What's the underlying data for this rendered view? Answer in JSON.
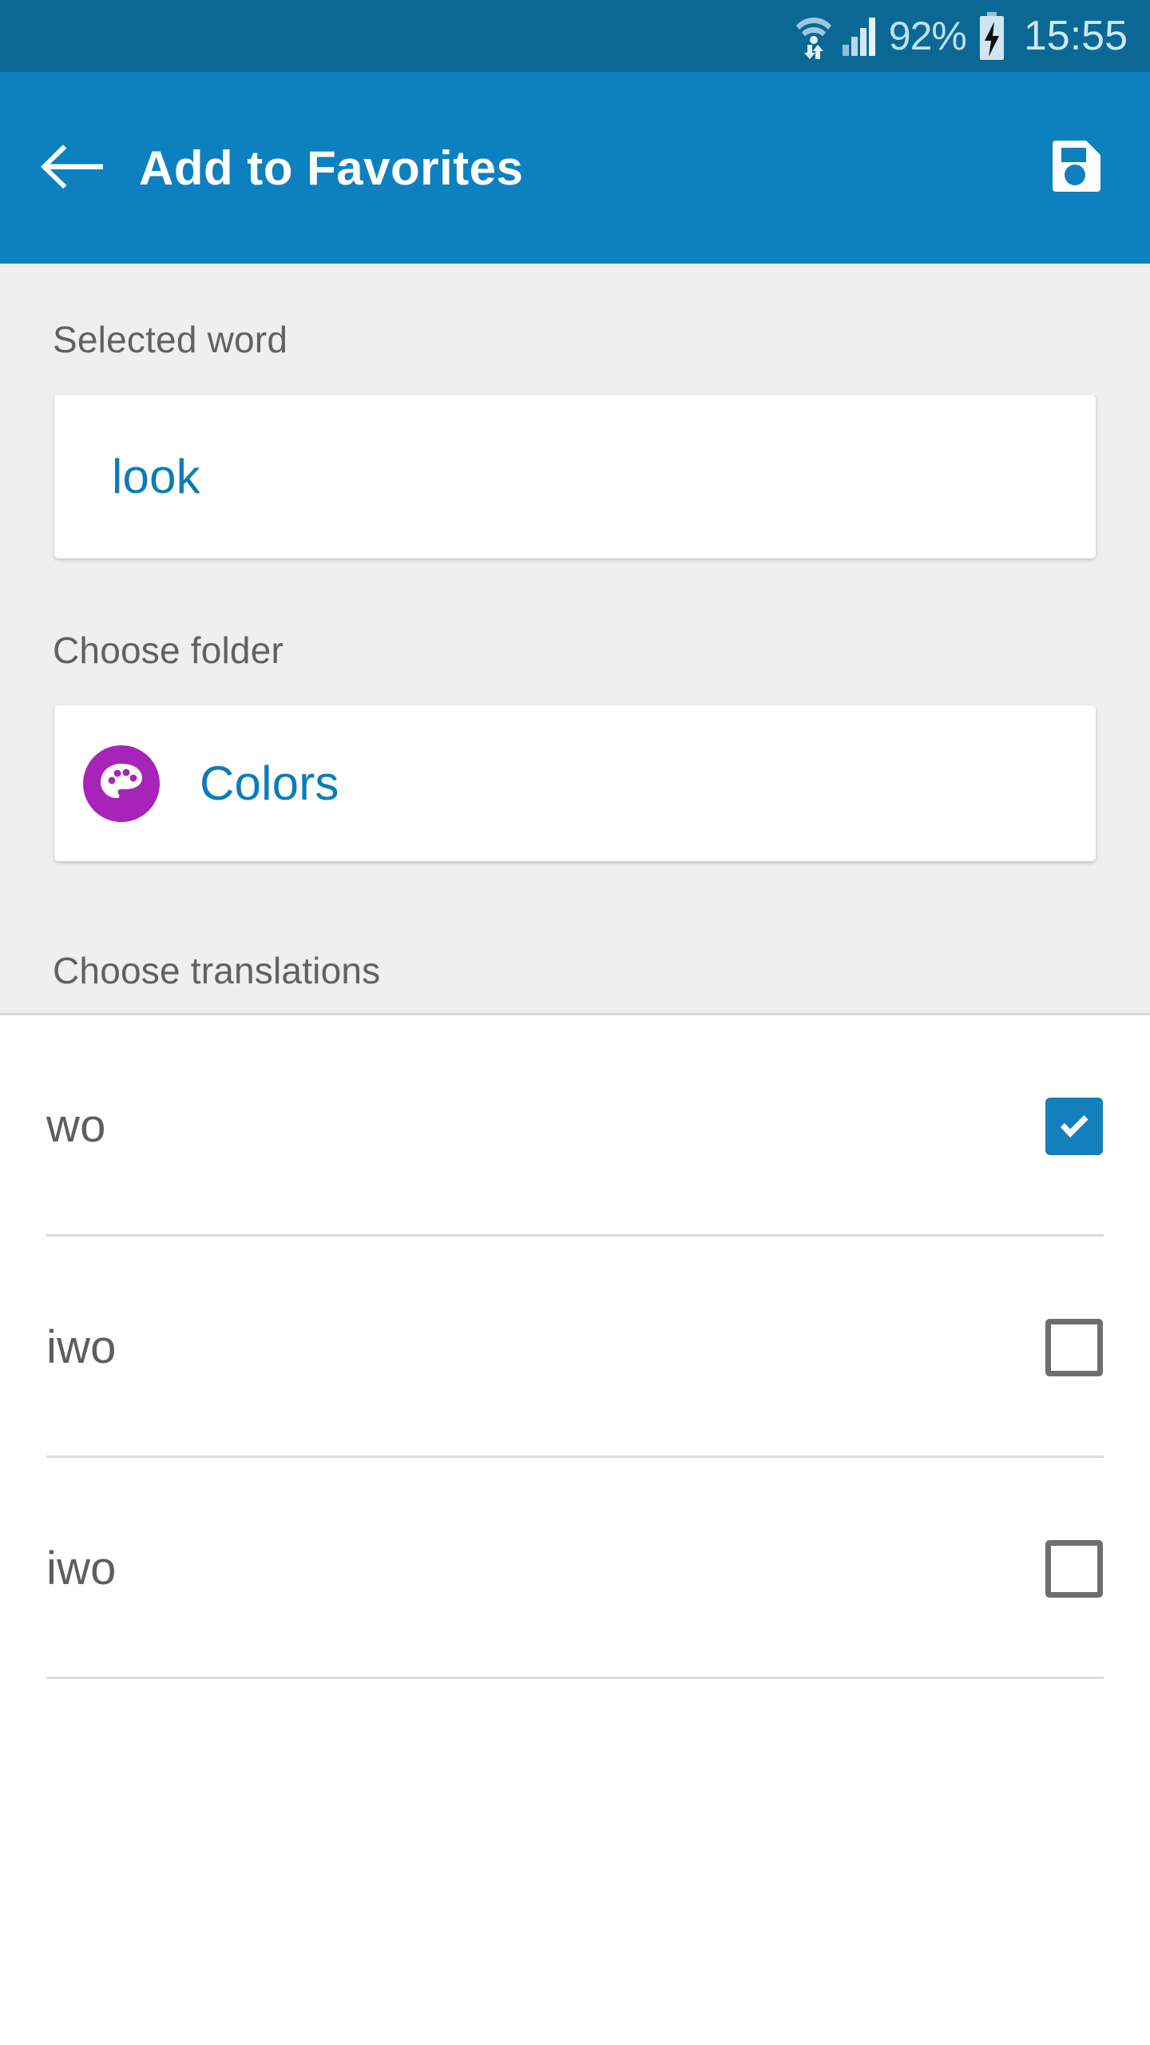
{
  "status_bar": {
    "wifi_icon": "wifi-data-transfer-icon",
    "signal_icon": "cellular-signal-icon",
    "battery_percent": "92%",
    "battery_icon": "battery-charging-icon",
    "clock": "15:55",
    "background_color": "#0B6894",
    "text_color": "#CFE7F4"
  },
  "app_bar": {
    "back_icon": "arrow-left-icon",
    "title": "Add to Favorites",
    "save_icon": "floppy-disk-save-icon",
    "background_color": "#0D80BF",
    "title_color": "#FFFFFF"
  },
  "content": {
    "background_color": "#EFEFEF",
    "selected_word": {
      "label": "Selected word",
      "value": "look",
      "value_color": "#0C7CB8"
    },
    "choose_folder": {
      "label": "Choose folder",
      "folder_name": "Colors",
      "folder_icon": "palette-icon",
      "folder_icon_bg": "#A624B8",
      "name_color": "#0C7CB8"
    },
    "choose_translations": {
      "label": "Choose translations",
      "rows": [
        {
          "label": "wo",
          "checked": true
        },
        {
          "label": "iwo",
          "checked": false
        },
        {
          "label": "iwo",
          "checked": false
        }
      ],
      "checked_color": "#1380BC",
      "unchecked_border_color": "#6E6E6E"
    }
  }
}
